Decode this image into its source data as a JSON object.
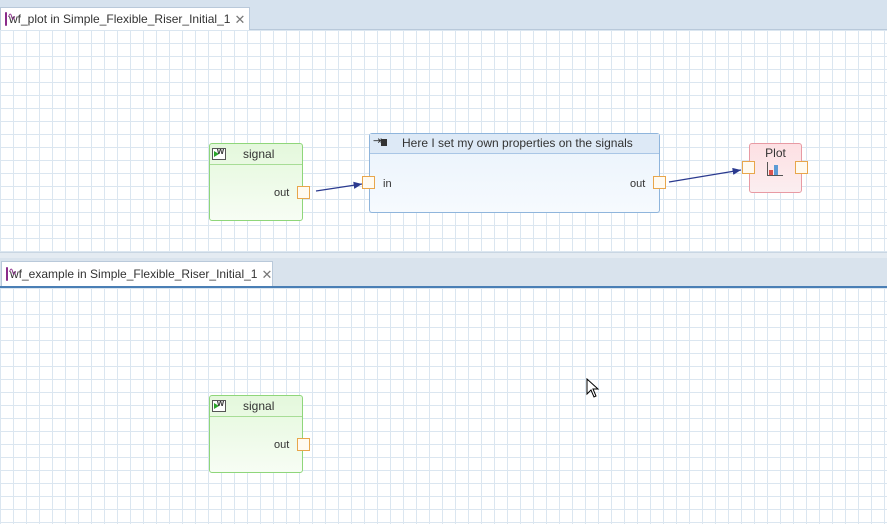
{
  "tabs": [
    {
      "label": "wf_plot in Simple_Flexible_Riser_Initial_1",
      "close": "✕"
    },
    {
      "label": "wf_example in Simple_Flexible_Riser_Initial_1",
      "close": "✕"
    }
  ],
  "top_workflow": {
    "signal_node": {
      "title": "signal",
      "out_label": "out"
    },
    "task_node": {
      "title": "Here I set my own properties on the signals",
      "in_label": "in",
      "out_label": "out"
    },
    "plot_node": {
      "title": "Plot"
    }
  },
  "bottom_workflow": {
    "signal_node": {
      "title": "signal",
      "out_label": "out"
    }
  },
  "colors": {
    "signal_border": "#8fd67a",
    "task_border": "#8fb5dc",
    "plot_border": "#e89aa3",
    "port_border": "#e8a64b",
    "wire": "#2b3a8f"
  },
  "icons": {
    "tab_icon": "workflow-icon",
    "signal_icon": "signal-icon",
    "task_icon": "task-icon",
    "plot_icon": "plot-chart-icon",
    "cursor": "mouse-pointer-icon"
  }
}
